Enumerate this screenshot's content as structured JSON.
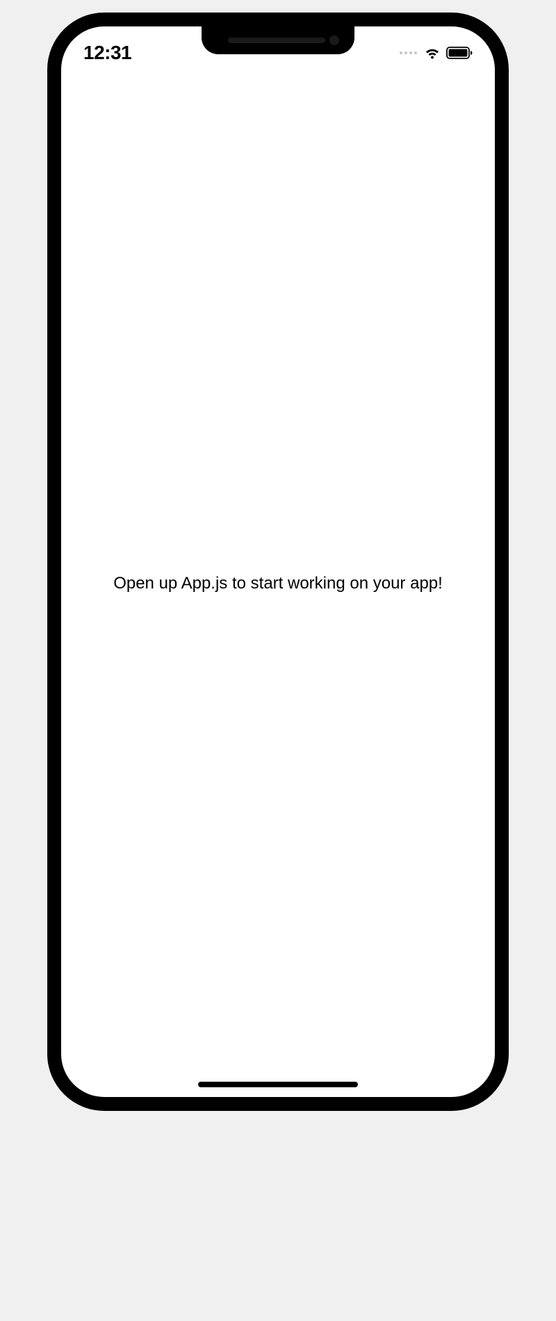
{
  "status_bar": {
    "time": "12:31"
  },
  "app": {
    "welcome_message": "Open up App.js to start working on your app!"
  }
}
